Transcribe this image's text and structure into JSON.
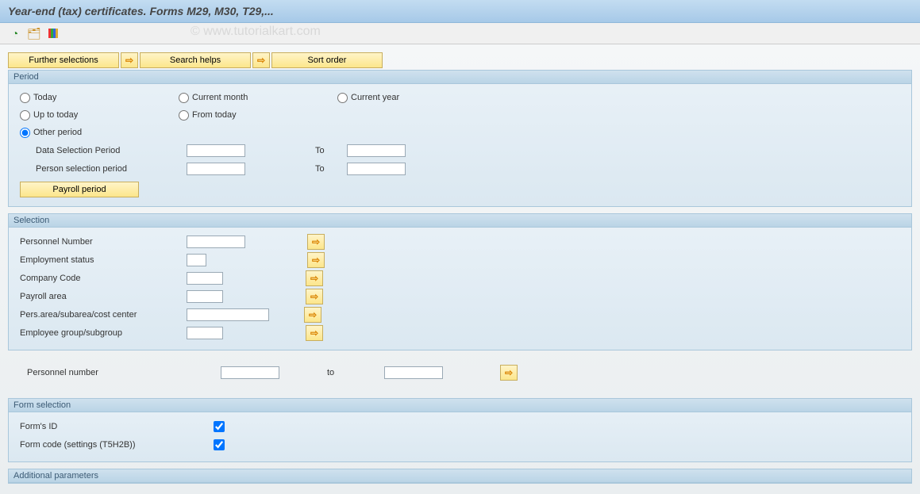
{
  "title": "Year-end (tax) certificates. Forms M29, M30, T29,...",
  "watermark": "© www.tutorialkart.com",
  "topButtons": {
    "further": "Further selections",
    "search": "Search helps",
    "sort": "Sort order"
  },
  "period": {
    "title": "Period",
    "opt_today": "Today",
    "opt_curmonth": "Current month",
    "opt_curyear": "Current year",
    "opt_uptotoday": "Up to today",
    "opt_fromtoday": "From today",
    "opt_other": "Other period",
    "lbl_datasel": "Data Selection Period",
    "lbl_personsel": "Person selection period",
    "to": "To",
    "payrollBtn": "Payroll period"
  },
  "selection": {
    "title": "Selection",
    "rows": {
      "persnum": "Personnel Number",
      "empstat": "Employment status",
      "company": "Company Code",
      "payarea": "Payroll area",
      "persarea": "Pers.area/subarea/cost center",
      "empgroup": "Employee group/subgroup"
    }
  },
  "loose": {
    "persnum": "Personnel number",
    "to": "to"
  },
  "formsel": {
    "title": "Form selection",
    "formid": "Form's ID",
    "formcode": "Form code (settings (T5H2B))"
  },
  "addparam": {
    "title": "Additional parameters"
  }
}
